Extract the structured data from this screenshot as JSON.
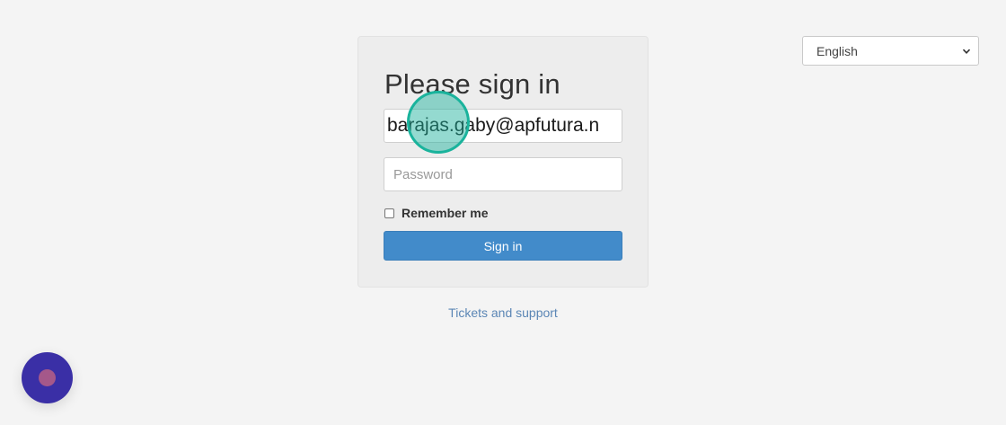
{
  "language_select": {
    "selected": "English"
  },
  "login": {
    "title": "Please sign in",
    "email_value": "barajas.gaby@apfutura.n",
    "password_placeholder": "Password",
    "remember_label": "Remember me",
    "remember_checked": false,
    "submit_label": "Sign in"
  },
  "footer": {
    "support_link": "Tickets and support"
  },
  "icons": {
    "language_dropdown": "chevron-down-icon",
    "chat_launcher": "chat-icon"
  },
  "colors": {
    "primary_button": "#428bca",
    "link": "#5b86b5",
    "click_marker": "#1ab39c",
    "chat_launcher": "#3a2fa6"
  }
}
